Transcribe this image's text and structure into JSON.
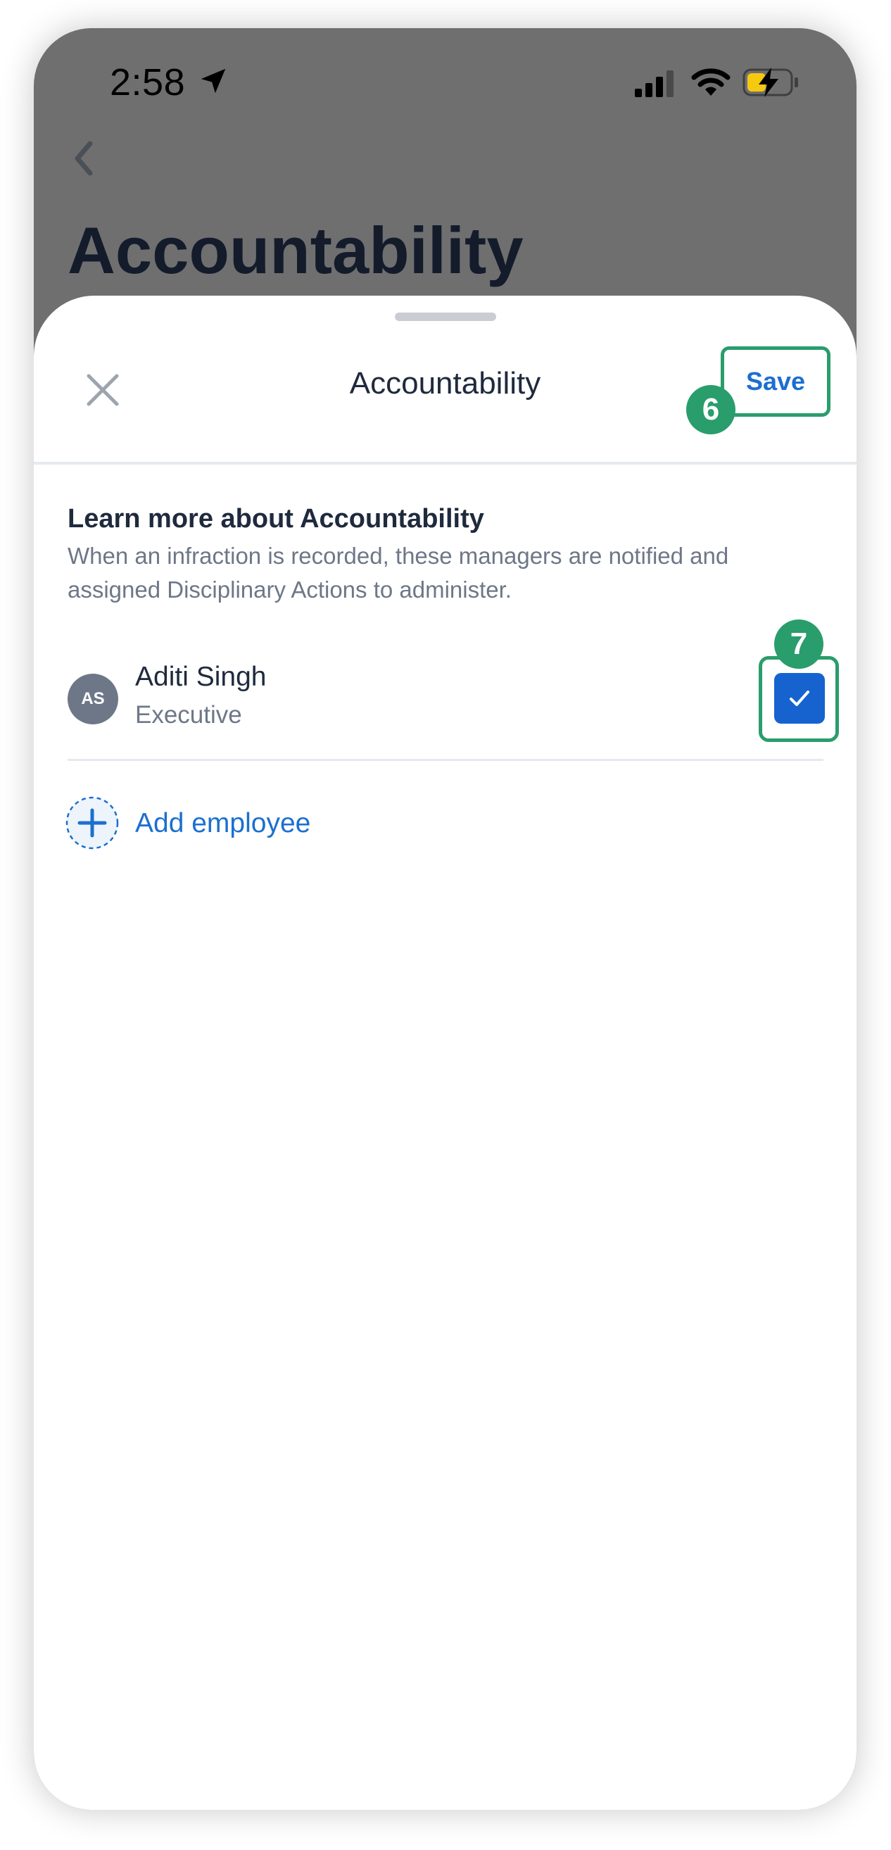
{
  "status_bar": {
    "time": "2:58",
    "icons": [
      "location-arrow-icon",
      "signal-icon",
      "wifi-icon",
      "battery-charging-icon"
    ]
  },
  "background_page": {
    "title": "Accountability",
    "back_icon": "chevron-left-icon"
  },
  "sheet": {
    "title": "Accountability",
    "close_icon": "close-icon",
    "save_label": "Save",
    "info_title": "Learn more about Accountability",
    "info_description": "When an infraction is recorded, these managers are notified and assigned Disciplinary Actions to administer.",
    "employees": [
      {
        "initials": "AS",
        "name": "Aditi Singh",
        "role": "Executive",
        "checked": true
      }
    ],
    "add_employee_label": "Add employee"
  },
  "annotations": {
    "save_badge": "6",
    "checkbox_badge": "7"
  },
  "colors": {
    "accent": "#1c6fd0",
    "checkbox": "#1663d0",
    "annotation_green": "#2a9d6c",
    "overlay": "#6f6f6f",
    "battery_yellow": "#f5c90f"
  }
}
